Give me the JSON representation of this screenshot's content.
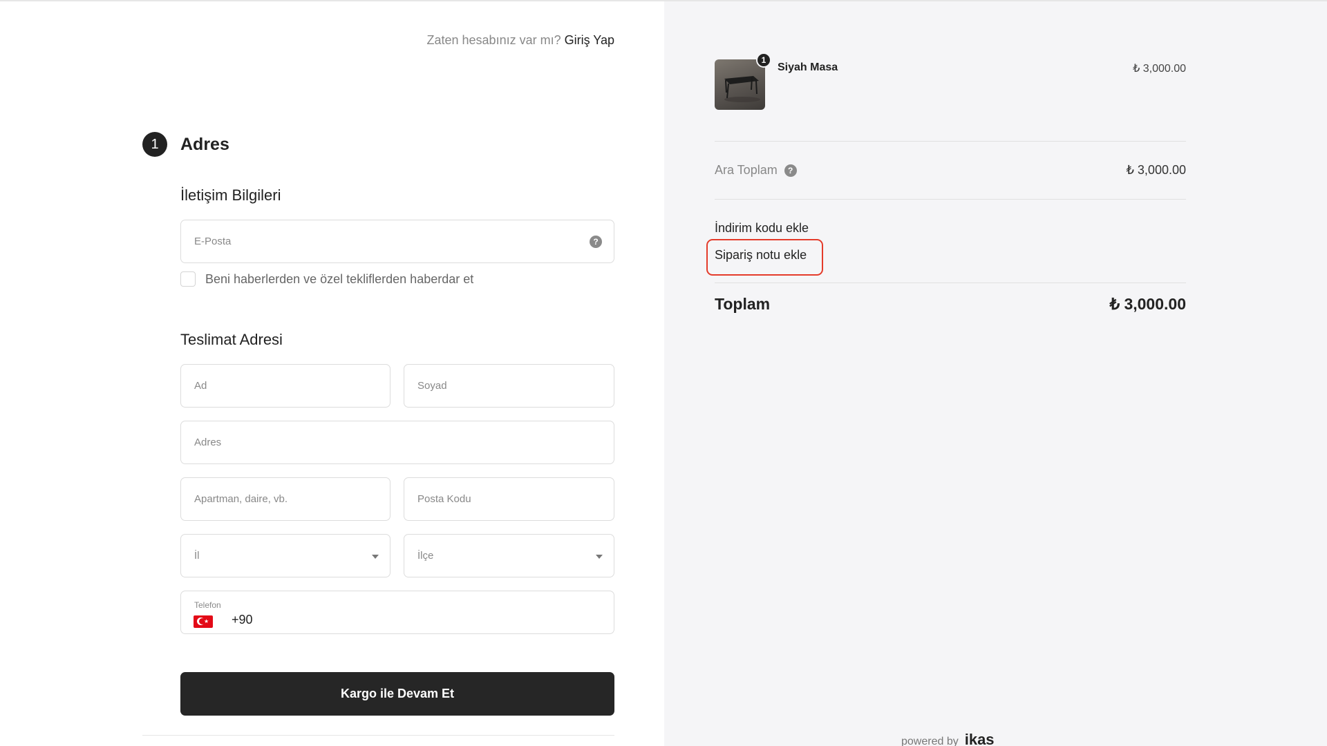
{
  "login": {
    "prompt": "Zaten hesabınız var mı?",
    "link": "Giriş Yap"
  },
  "step": {
    "number": "1",
    "title": "Adres"
  },
  "contact": {
    "title": "İletişim Bilgileri",
    "email_placeholder": "E-Posta",
    "help_icon": "?",
    "newsletter_label": "Beni haberlerden ve özel tekliflerden haberdar et"
  },
  "delivery": {
    "title": "Teslimat Adresi",
    "first_name_placeholder": "Ad",
    "last_name_placeholder": "Soyad",
    "address_placeholder": "Adres",
    "apartment_placeholder": "Apartman, daire, vb.",
    "postal_code_placeholder": "Posta Kodu",
    "province_placeholder": "İl",
    "district_placeholder": "İlçe",
    "phone_label": "Telefon",
    "phone_code": "+90"
  },
  "cta": {
    "label": "Kargo ile Devam Et"
  },
  "cart": {
    "item": {
      "name": "Siyah Masa",
      "price": "₺ 3,000.00",
      "quantity": "1"
    },
    "subtotal_label": "Ara Toplam",
    "subtotal_value": "₺ 3,000.00",
    "discount_link": "İndirim kodu ekle",
    "note_link": "Sipariş notu ekle",
    "total_label": "Toplam",
    "total_value": "₺ 3,000.00"
  },
  "footer": {
    "powered_by": "powered by",
    "brand": "ikas"
  },
  "colors": {
    "accent": "#262626",
    "highlight": "#e43b2a",
    "panel_bg": "#f5f5f7"
  }
}
